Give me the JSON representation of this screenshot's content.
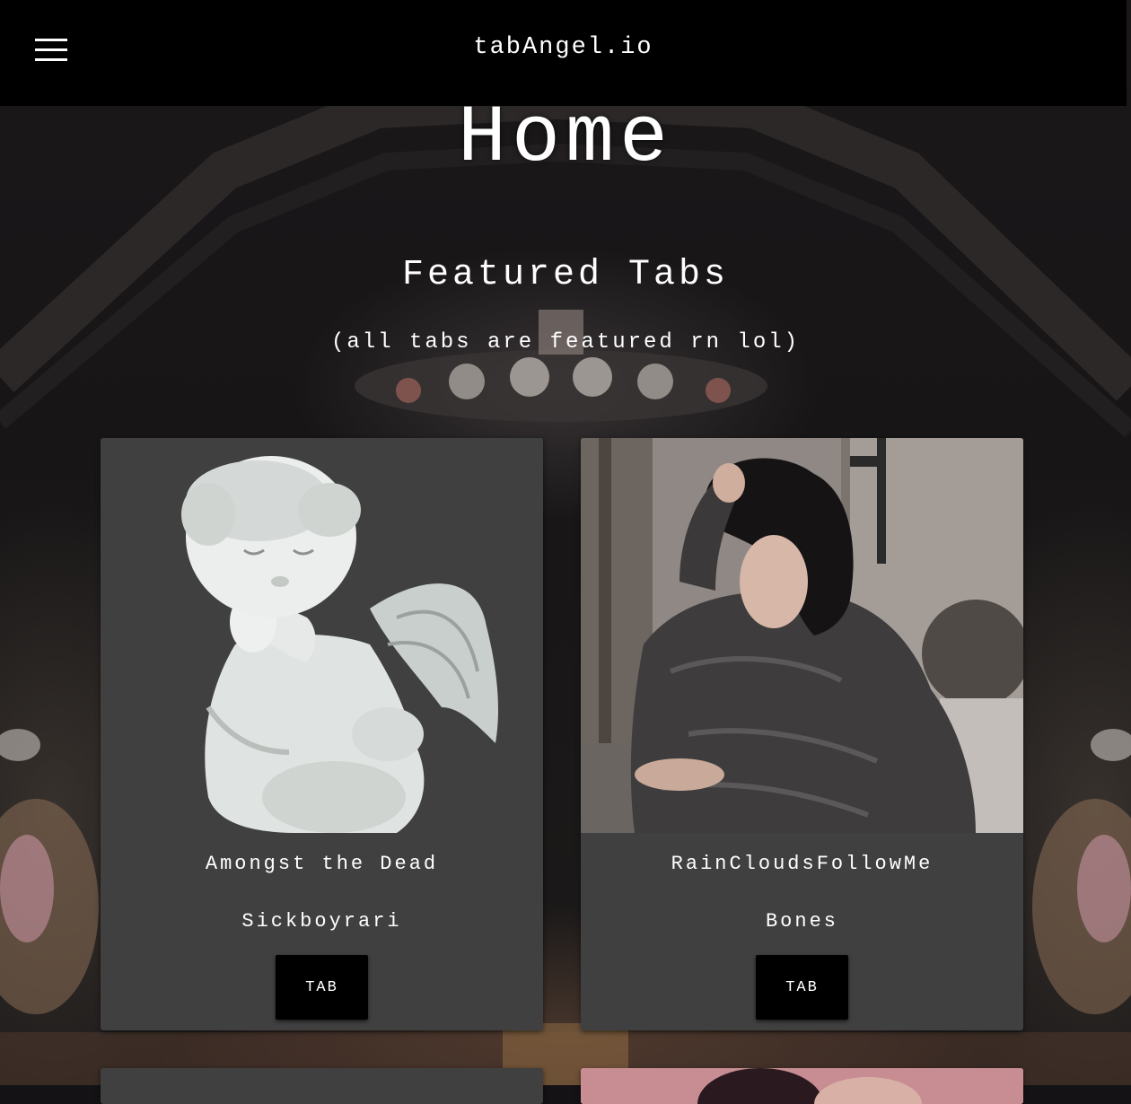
{
  "header": {
    "brand": "tabAngel.io",
    "menu_icon": "hamburger-menu-icon"
  },
  "page": {
    "title": "Home",
    "section_title": "Featured Tabs",
    "section_subtitle": "(all tabs are featured rn lol)"
  },
  "cards": [
    {
      "song": "Amongst the Dead",
      "artist": "Sickboyrari",
      "button": "TAB",
      "image": "cherub-angel-statue-image"
    },
    {
      "song": "RainCloudsFollowMe",
      "artist": "Bones",
      "button": "TAB",
      "image": "artist-portrait-image"
    }
  ],
  "colors": {
    "topbar": "#000000",
    "card": "#404040",
    "button": "#000000",
    "text": "#ffffff"
  }
}
